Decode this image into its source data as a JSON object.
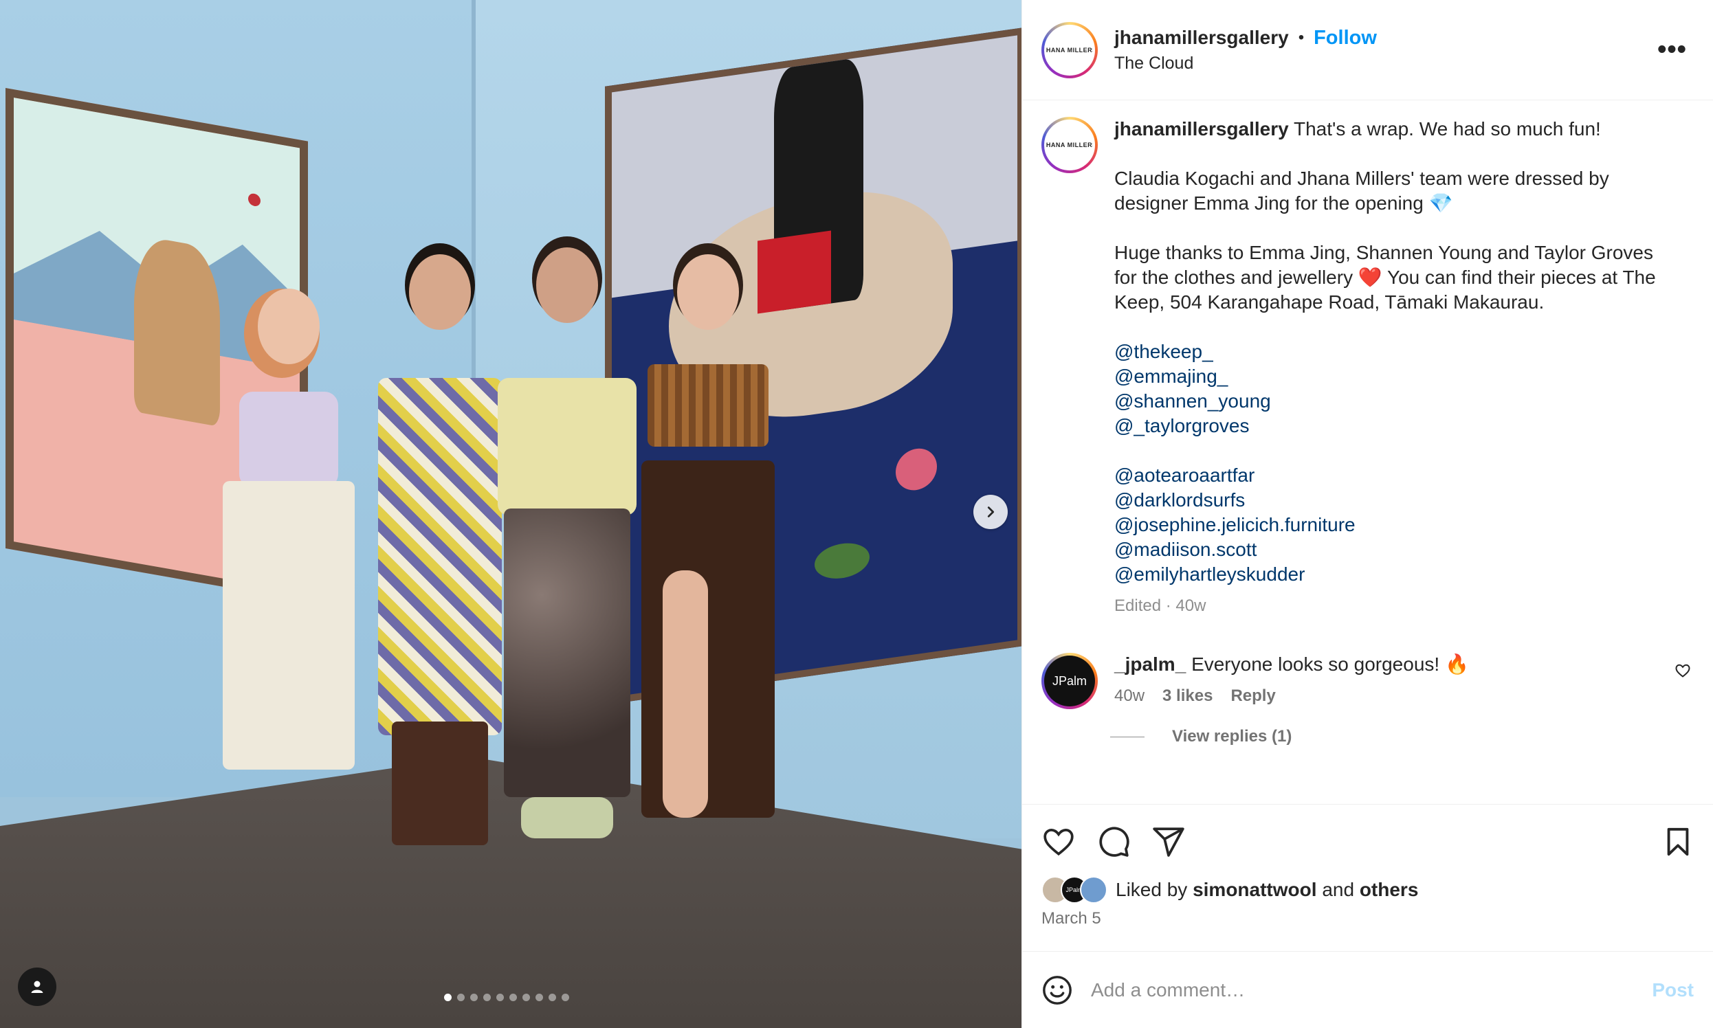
{
  "post": {
    "username": "jhanamillersgallery",
    "avatar_logo": "JHANA MILLERS",
    "follow_label": "Follow",
    "separator": "•",
    "location": "The Cloud",
    "more_label": "•••",
    "caption": {
      "first_line": "That's a wrap. We had so much fun!",
      "para2": "Claudia Kogachi and Jhana Millers' team were dressed by designer Emma Jing for the opening 💎",
      "para3": "Huge thanks to Emma Jing, Shannen Young and Taylor Groves for the clothes and jewellery ❤️ You can find their pieces at The Keep, 504 Karangahape Road, Tāmaki Makaurau.",
      "mentions_group1": [
        "@thekeep_",
        "@emmajing_",
        "@shannen_young",
        "@_taylorgroves"
      ],
      "mentions_group2": [
        "@aotearoaartfar",
        "@darklordsurfs",
        "@josephine.jelicich.furniture",
        "@madiison.scott",
        "@emilyhartleyskudder"
      ],
      "meta": "Edited · 40w"
    },
    "comment": {
      "avatar_text": "JPalm",
      "username": "_jpalm_",
      "text": "Everyone looks so gorgeous! 🔥",
      "age": "40w",
      "likes": "3 likes",
      "reply_label": "Reply",
      "view_replies": "View replies (1)"
    },
    "likes": {
      "prefix": "Liked by",
      "user": "simonattwool",
      "and": "and",
      "others": "others",
      "mini_avatar_text": "JPalm"
    },
    "date": "March 5",
    "add_comment": {
      "placeholder": "Add a comment…",
      "post_label": "Post"
    },
    "carousel": {
      "total": 10,
      "active_index": 0
    }
  },
  "colors": {
    "link_blue": "#0095f6",
    "mention_blue": "#00376b",
    "muted_gray": "#737373",
    "post_disabled": "#b2dffc"
  },
  "icons": [
    "user-tag-icon",
    "chevron-right-icon",
    "more-icon",
    "heart-icon",
    "comment-icon",
    "share-icon",
    "bookmark-icon",
    "emoji-icon"
  ]
}
